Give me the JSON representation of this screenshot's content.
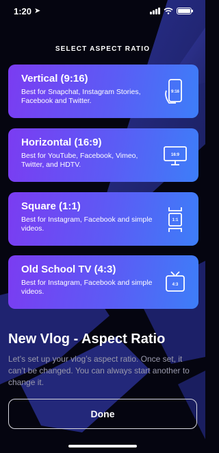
{
  "status": {
    "time": "1:20",
    "location_icon": "location-arrow-icon",
    "signal_icon": "cellular-signal-icon",
    "wifi_icon": "wifi-icon",
    "battery_icon": "battery-icon"
  },
  "header": {
    "title": "SELECT ASPECT RATIO"
  },
  "options": [
    {
      "title": "Vertical (9:16)",
      "description": "Best for Snapchat, Instagram Stories, Facebook and Twitter.",
      "icon": "phone-vertical-icon",
      "icon_label": "9:16"
    },
    {
      "title": "Horizontal (16:9)",
      "description": "Best for YouTube, Facebook, Vimeo, Twitter, and HDTV.",
      "icon": "monitor-widescreen-icon",
      "icon_label": "16:9"
    },
    {
      "title": "Square (1:1)",
      "description": "Best for Instagram, Facebook and simple videos.",
      "icon": "square-frame-icon",
      "icon_label": "1:1"
    },
    {
      "title": "Old School TV (4:3)",
      "description": "Best for Instagram, Facebook and simple videos.",
      "icon": "retro-tv-icon",
      "icon_label": "4:3"
    }
  ],
  "footer": {
    "heading": "New Vlog - Aspect Ratio",
    "description": "Let’s set up your vlog’s aspect ratio. Once set, it can’t be changed. You can always start another to change it.",
    "done_label": "Done"
  },
  "colors": {
    "card_start": "#7b3cf2",
    "card_end": "#3d7ef8",
    "background": "#050510",
    "muted_text": "#9a9aac"
  }
}
